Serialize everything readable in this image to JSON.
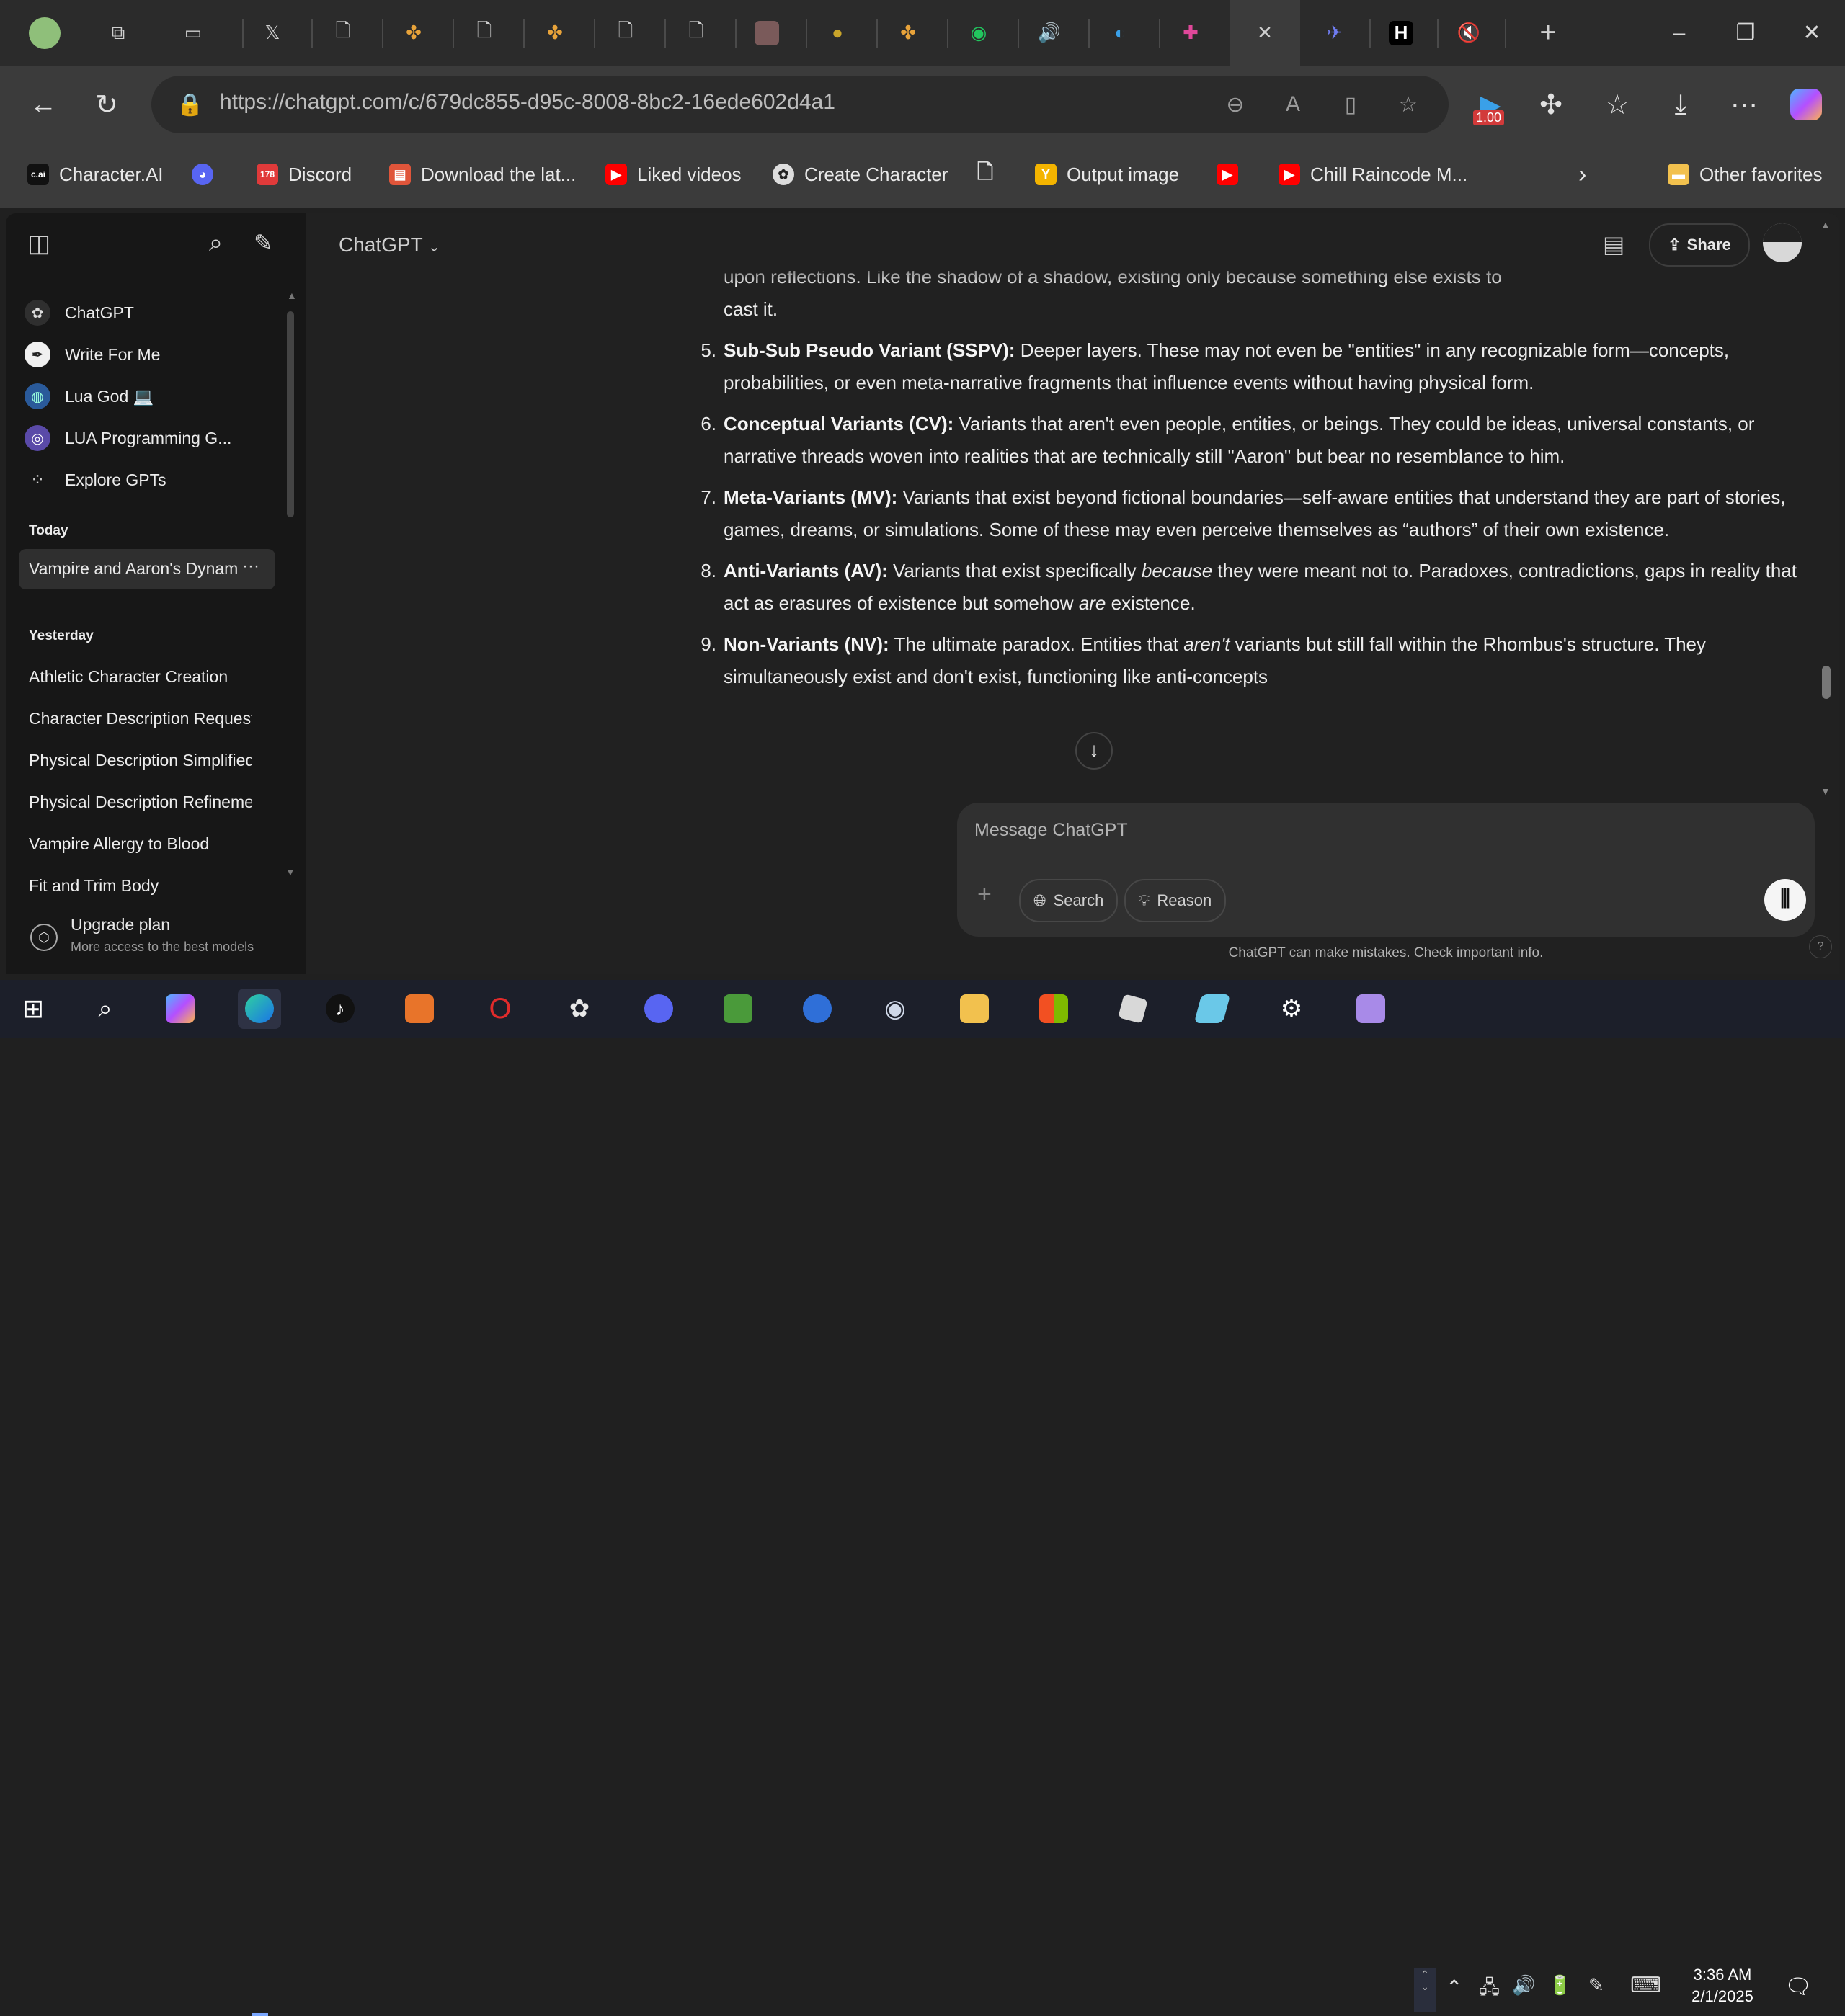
{
  "browser": {
    "url": "https://chatgpt.com/c/679dc855-d95c-8008-8bc2-16ede602d4a1",
    "extension_badge": "1.00",
    "tab_close_glyph": "✕",
    "new_tab_glyph": "+",
    "window_controls": {
      "minimize": "–",
      "restore": "❐",
      "close": "✕"
    }
  },
  "favorites": {
    "items": [
      {
        "label": "Character.AI",
        "icon": "c.ai",
        "color": "#111111"
      },
      {
        "label": "",
        "icon": "discord-icon",
        "color": "#5865f2"
      },
      {
        "label": "Discord",
        "icon": "178",
        "color": "#e03a3a"
      },
      {
        "label": "Download the lat...",
        "icon": "download-icon",
        "color": "#e0553a"
      },
      {
        "label": "Liked videos",
        "icon": "youtube-icon",
        "color": "#ff0000"
      },
      {
        "label": "Create Character",
        "icon": "openai-icon",
        "color": "#dddddd"
      },
      {
        "label": "",
        "icon": "file-icon",
        "color": "#cccccc"
      },
      {
        "label": "Output image",
        "icon": "y-icon",
        "color": "#f4b400"
      },
      {
        "label": "",
        "icon": "youtube-icon",
        "color": "#ff0000"
      },
      {
        "label": "Chill Raincode M...",
        "icon": "youtube-icon",
        "color": "#ff0000"
      }
    ],
    "other_favorites": "Other favorites"
  },
  "sidebar": {
    "gpts": [
      {
        "label": "ChatGPT",
        "icon": "openai-icon"
      },
      {
        "label": "Write For Me",
        "icon": "pen-icon"
      },
      {
        "label": "Lua God 💻",
        "icon": "globe-icon"
      },
      {
        "label": "LUA Programming G...",
        "icon": "lua-icon"
      },
      {
        "label": "Explore GPTs",
        "icon": "grid-icon"
      }
    ],
    "today_label": "Today",
    "today": [
      "Vampire and Aaron's Dynamic"
    ],
    "more_glyph": "···",
    "yesterday_label": "Yesterday",
    "yesterday": [
      "Athletic Character Creation",
      "Character Description Request",
      "Physical Description Simplified",
      "Physical Description Refinement",
      "Vampire Allergy to Blood",
      "Fit and Trim Body"
    ],
    "upgrade_title": "Upgrade plan",
    "upgrade_sub": "More access to the best models"
  },
  "header": {
    "model": "ChatGPT",
    "share": "Share"
  },
  "chat": {
    "intro_line1": "upon reflections. Like the shadow of a shadow, existing only because something else exists to",
    "intro_line2": "cast it.",
    "items": [
      {
        "num": "5.",
        "term": "Sub-Sub Pseudo Variant (SSPV):",
        "text": " Deeper layers. These may not even be \"entities\" in any recognizable form—concepts, probabilities, or even meta-narrative fragments that influence events without having physical form."
      },
      {
        "num": "6.",
        "term": "Conceptual Variants (CV):",
        "text": " Variants that aren't even people, entities, or beings. They could be ideas, universal constants, or narrative threads woven into realities that are technically still \"Aaron\" but bear no resemblance to him."
      },
      {
        "num": "7.",
        "term": "Meta-Variants (MV):",
        "text": " Variants that exist beyond fictional boundaries—self-aware entities that understand they are part of stories, games, dreams, or simulations. Some of these may even perceive themselves as “authors” of their own existence."
      },
      {
        "num": "8.",
        "term": "Anti-Variants (AV):",
        "text_a": " Variants that exist specifically ",
        "em_a": "because",
        "text_b": " they were meant not to. Paradoxes, contradictions, gaps in reality that act as erasures of existence but somehow ",
        "em_b": "are",
        "text_c": " existence."
      },
      {
        "num": "9.",
        "term": "Non-Variants (NV):",
        "text_a": " The ultimate paradox. Entities that ",
        "em_a": "aren't",
        "text_b": " variants but still fall within the Rhombus's structure. They simultaneously exist and don't exist, functioning like anti-concepts"
      }
    ]
  },
  "composer": {
    "placeholder": "Message ChatGPT",
    "search": "Search",
    "reason": "Reason",
    "disclaimer": "ChatGPT can make mistakes. Check important info.",
    "help": "?"
  },
  "taskbar": {
    "time": "3:36 AM",
    "date": "2/1/2025"
  }
}
